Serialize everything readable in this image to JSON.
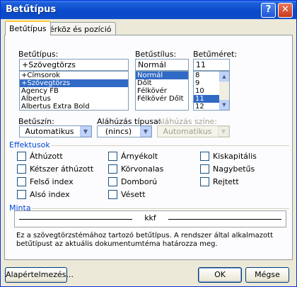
{
  "window": {
    "title": "Betűtípus",
    "help_glyph": "?",
    "close_glyph": "✕"
  },
  "tabs": [
    {
      "label": "Betűtípus",
      "active": true
    },
    {
      "label": "Térköz és pozíció",
      "active": false
    }
  ],
  "font": {
    "label": "Betűtípus:",
    "value": "+Szövegtörzs",
    "items": [
      "+Címsorok",
      "+Szövegtörzs",
      "Agency FB",
      "Albertus",
      "Albertus Extra Bold"
    ],
    "selected_index": 1
  },
  "style": {
    "label": "Betűstílus:",
    "value": "Normál",
    "items": [
      "Normál",
      "Dőlt",
      "Félkövér",
      "Félkövér Dőlt"
    ],
    "selected_index": 0
  },
  "size": {
    "label": "Betűméret:",
    "value": "11",
    "items": [
      "8",
      "9",
      "10",
      "11",
      "12"
    ],
    "selected_index": 3
  },
  "color": {
    "label": "Betűszín:",
    "value": "Automatikus"
  },
  "underline_type": {
    "label": "Aláhúzás típusa:",
    "value": "(nincs)"
  },
  "underline_color": {
    "label": "Aláhúzás színe:",
    "value": "Automatikus",
    "disabled": true
  },
  "effects": {
    "title": "Effektusok",
    "col1": [
      {
        "label": "Áthúzott",
        "checked": false
      },
      {
        "label": "Kétszer áthúzott",
        "checked": false
      },
      {
        "label": "Felső index",
        "checked": false
      },
      {
        "label": "Alsó index",
        "checked": false
      }
    ],
    "col2": [
      {
        "label": "Árnyékolt",
        "checked": false
      },
      {
        "label": "Körvonalas",
        "checked": false
      },
      {
        "label": "Domború",
        "checked": false
      },
      {
        "label": "Vésett",
        "checked": false
      }
    ],
    "col3": [
      {
        "label": "Kiskapitális",
        "checked": false
      },
      {
        "label": "Nagybetűs",
        "checked": false
      },
      {
        "label": "Rejtett",
        "checked": false
      }
    ]
  },
  "preview": {
    "title": "Minta",
    "sample": "kkf",
    "description": "Ez a szövegtörzstémához tartozó betűtípus. A rendszer által alkalmazott betűtípust az aktuális dokumentumtéma határozza meg."
  },
  "buttons": {
    "default": "Alapértelmezés...",
    "ok": "OK",
    "cancel": "Mégse"
  },
  "icons": {
    "scroll_up": "▲",
    "scroll_down": "▼",
    "dropdown": "▼"
  },
  "colors": {
    "accent": "#0046d5",
    "selection": "#316ac5",
    "titlebar": "#0a4bcc"
  }
}
